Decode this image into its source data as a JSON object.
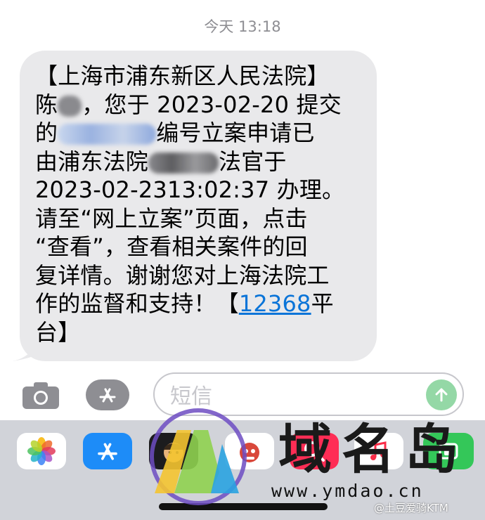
{
  "header": {
    "timestamp": "今天 13:18"
  },
  "message": {
    "line1": "【上海市浦东新区人民法院】",
    "line2_a": "陈",
    "line2_b": "，您于 2023-02-20 提交",
    "line3_a": "的",
    "line3_b": "编号立案申请已",
    "line4_a": "由浦东法院",
    "line4_b": "法官于",
    "line5": "2023-02-2313:02:37 办理。",
    "line6": "请至“网上立案”页面，点击",
    "line7": "“查看”，查看相关案件的回",
    "line8": "复详情。谢谢您对上海法院工",
    "line9_a": "作的监督和支持！【",
    "line9_link": "12368",
    "line9_b": "平",
    "line10": "台】"
  },
  "composer": {
    "placeholder": "短信"
  },
  "app_drawer": {
    "icons": [
      "photos-icon",
      "app-store-icon",
      "memoji-icon",
      "animoji-icon",
      "search-images-icon",
      "music-icon",
      "more-apps-icon"
    ]
  },
  "watermark": {
    "title": "域名岛",
    "url": "www.ymdao.cn",
    "weibo": "@土豆爱骑KTM"
  },
  "colors": {
    "bubble": "#e9e9eb",
    "link": "#0a74d8",
    "send": "#94d8a6",
    "drawer": "#d1d3d9"
  }
}
